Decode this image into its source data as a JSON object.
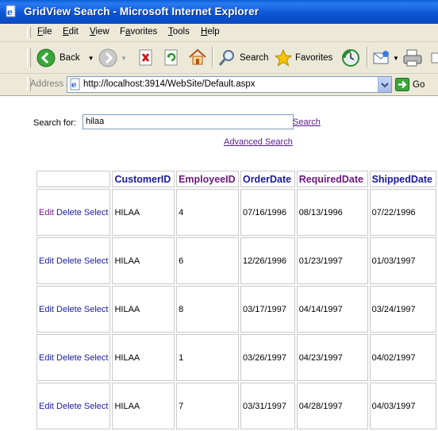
{
  "window": {
    "title": "GridView Search - Microsoft Internet Explorer"
  },
  "menu": [
    {
      "pre": "",
      "u": "F",
      "post": "ile"
    },
    {
      "pre": "",
      "u": "E",
      "post": "dit"
    },
    {
      "pre": "",
      "u": "V",
      "post": "iew"
    },
    {
      "pre": "F",
      "u": "a",
      "post": "vorites"
    },
    {
      "pre": "",
      "u": "T",
      "post": "ools"
    },
    {
      "pre": "",
      "u": "H",
      "post": "elp"
    }
  ],
  "toolbar": {
    "back": "Back",
    "search": "Search",
    "favorites": "Favorites"
  },
  "address": {
    "label": "Address",
    "url": "http://localhost:3914/WebSite/Default.aspx",
    "go": "Go"
  },
  "search": {
    "label": "Search for:",
    "value": "hilaa",
    "button": "Search",
    "advanced": "Advanced Search"
  },
  "grid": {
    "columns": [
      "",
      "CustomerID",
      "EmployeeID",
      "OrderDate",
      "RequiredDate",
      "ShippedDate"
    ],
    "commands": [
      "Edit",
      "Delete",
      "Select"
    ],
    "rows": [
      {
        "customer": "HILAA",
        "employee": "4",
        "order": "07/16/1996",
        "required": "08/13/1996",
        "shipped": "07/22/1996"
      },
      {
        "customer": "HILAA",
        "employee": "6",
        "order": "12/26/1996",
        "required": "01/23/1997",
        "shipped": "01/03/1997"
      },
      {
        "customer": "HILAA",
        "employee": "8",
        "order": "03/17/1997",
        "required": "04/14/1997",
        "shipped": "03/24/1997"
      },
      {
        "customer": "HILAA",
        "employee": "1",
        "order": "03/26/1997",
        "required": "04/23/1997",
        "shipped": "04/02/1997"
      },
      {
        "customer": "HILAA",
        "employee": "7",
        "order": "03/31/1997",
        "required": "04/28/1997",
        "shipped": "04/03/1997"
      }
    ]
  },
  "colors": {
    "titlebar": "#0a5fd8",
    "chrome": "#ece9d8",
    "link": "#1a1a9c",
    "visited": "#6b1a7a"
  }
}
